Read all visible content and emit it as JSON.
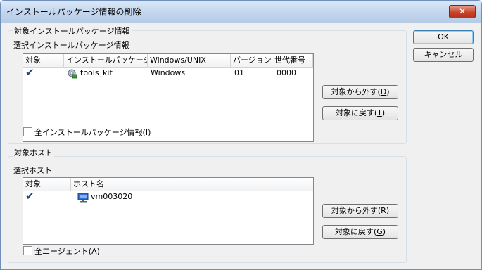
{
  "window": {
    "title": "インストールパッケージ情報の削除",
    "close_glyph": "✕"
  },
  "package_group": {
    "label": "対象インストールパッケージ情報",
    "list_label": "選択インストールパッケージ情報",
    "columns": [
      "対象",
      "インストールパッケージ",
      "Windows/UNIX",
      "バージョン",
      "世代番号"
    ],
    "rows": [
      {
        "checked": "✔",
        "name": "tools_kit",
        "os": "Windows",
        "version": "01",
        "generation": "0000",
        "icon": "package-icon"
      }
    ],
    "remove_button": {
      "text": "対象から外す(",
      "key": "D",
      "end": ")"
    },
    "restore_button": {
      "text": "対象に戻す(",
      "key": "T",
      "end": ")"
    },
    "all_checkbox": {
      "text": "全インストールパッケージ情報(",
      "key": "I",
      "end": ")",
      "checked": false
    }
  },
  "host_group": {
    "label": "対象ホスト",
    "list_label": "選択ホスト",
    "columns": [
      "対象",
      "ホスト名"
    ],
    "rows": [
      {
        "checked": "✔",
        "host": "vm003020",
        "icon": "computer-icon"
      }
    ],
    "remove_button": {
      "text": "対象から外す(",
      "key": "R",
      "end": ")"
    },
    "restore_button": {
      "text": "対象に戻す(",
      "key": "G",
      "end": ")"
    },
    "all_checkbox": {
      "text": "全エージェント(",
      "key": "A",
      "end": ")",
      "checked": false
    }
  },
  "ok_button": "OK",
  "cancel_button": "キャンセル",
  "colors": {
    "titlebar": "#c3d6ee",
    "close": "#c9442b",
    "check": "#23457a"
  }
}
